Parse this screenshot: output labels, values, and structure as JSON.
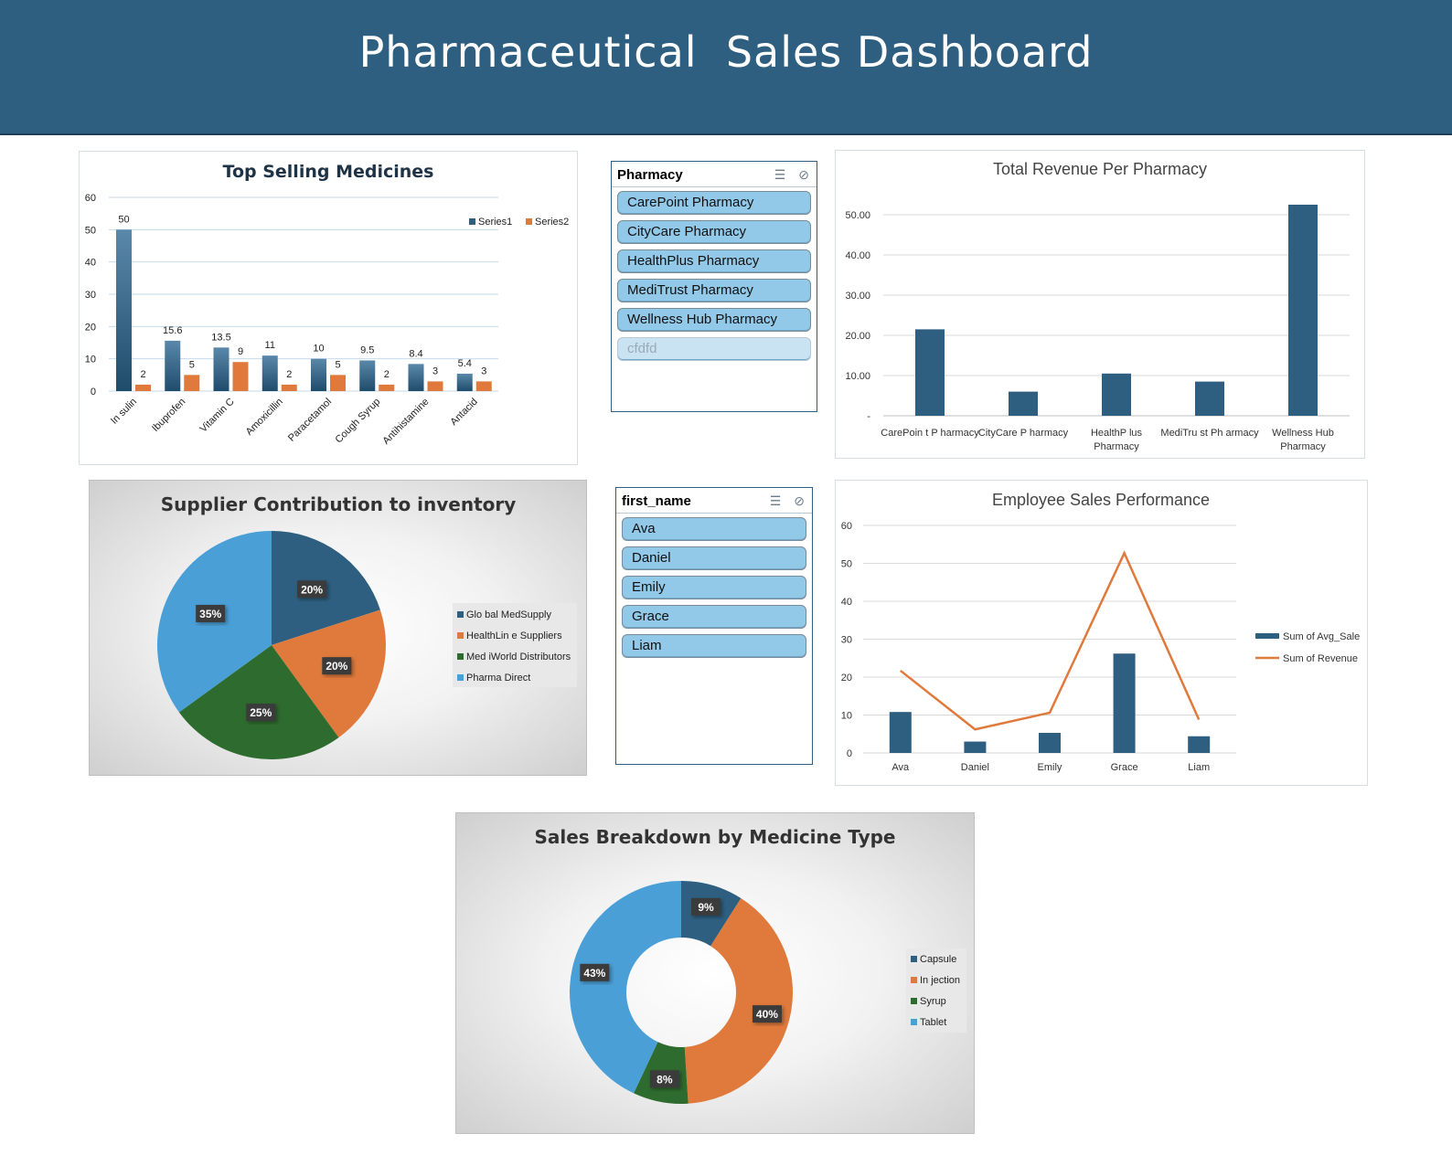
{
  "title": "Pharmaceutical  Sales Dashboard",
  "slicers": {
    "pharmacy": {
      "title": "Pharmacy",
      "items": [
        {
          "label": "CarePoint Pharmacy",
          "active": true
        },
        {
          "label": "CityCare Pharmacy",
          "active": true
        },
        {
          "label": "HealthPlus Pharmacy",
          "active": true
        },
        {
          "label": "MediTrust Pharmacy",
          "active": true
        },
        {
          "label": "Wellness Hub Pharmacy",
          "active": true
        },
        {
          "label": "cfdfd",
          "active": false
        }
      ]
    },
    "first_name": {
      "title": "first_name",
      "items": [
        {
          "label": "Ava",
          "active": true
        },
        {
          "label": "Daniel",
          "active": true
        },
        {
          "label": "Emily",
          "active": true
        },
        {
          "label": "Grace",
          "active": true
        },
        {
          "label": "Liam",
          "active": true
        }
      ]
    }
  },
  "colors": {
    "dark_blue": "#2e5f80",
    "orange": "#e07a3c",
    "green": "#2e6b2e",
    "light_blue": "#4a9fd6"
  },
  "chart_data": [
    {
      "id": "top_selling",
      "type": "bar",
      "title": "Top Selling Medicines",
      "categories": [
        "Insulin",
        "Ibuprofen",
        "Vitamin C",
        "Amoxicillin",
        "Paracetamol",
        "Cough Syrup",
        "Antihistamine",
        "Antacid"
      ],
      "category_display": [
        "In sulin",
        "Ibuprofen",
        "Vitamin C",
        "Amoxicillin",
        "Paracetamol",
        "Cough Syrup",
        "Antihistamine",
        "Antacid"
      ],
      "series": [
        {
          "name": "Series1",
          "values": [
            50,
            15.6,
            13.5,
            11,
            10,
            9.5,
            8.4,
            5.4
          ]
        },
        {
          "name": "Series2",
          "values": [
            2,
            5,
            9,
            2,
            5,
            2,
            3,
            3
          ]
        }
      ],
      "yticks": [
        0,
        10,
        20,
        30,
        40,
        50,
        60
      ],
      "ylim": [
        0,
        60
      ],
      "legend": "top-right",
      "grid": true
    },
    {
      "id": "revenue_pharmacy",
      "type": "bar",
      "title": "Total Revenue Per Pharmacy",
      "categories": [
        "CarePoint Pharmacy",
        "CityCare Pharmacy",
        "HealthPlus Pharmacy",
        "MediTrust Pharmacy",
        "Wellness Hub Pharmacy"
      ],
      "category_lines": [
        [
          "CarePoin t P harmacy"
        ],
        [
          "CityCare P harmacy"
        ],
        [
          "HealthP lus",
          "Pharmacy"
        ],
        [
          "MediTru st Ph armacy"
        ],
        [
          "Wellness Hub",
          "Pharmacy"
        ]
      ],
      "series": [
        {
          "values": [
            21.5,
            6,
            10.5,
            8.5,
            52.5
          ]
        }
      ],
      "yticks": [
        "-",
        "10.00",
        "20.00",
        "30.00",
        "40.00",
        "50.00"
      ],
      "ylim": [
        0,
        55
      ],
      "grid": true
    },
    {
      "id": "supplier",
      "type": "pie",
      "title": "Supplier Contribution to inventory",
      "labels": [
        "Glo bal MedSupply",
        "HealthLin e Suppliers",
        "Med iWorld Distributors",
        "Pharma Direct"
      ],
      "values": [
        20,
        20,
        25,
        35
      ],
      "value_labels": [
        "20%",
        "20%",
        "25%",
        "35%"
      ],
      "legend": "right"
    },
    {
      "id": "employee",
      "type": "bar",
      "title": "Employee Sales Performance",
      "categories": [
        "Ava",
        "Daniel",
        "Emily",
        "Grace",
        "Liam"
      ],
      "series": [
        {
          "name": "Sum of Avg_Sale",
          "kind": "bar",
          "values": [
            10.8,
            3,
            5.3,
            26.2,
            4.4
          ]
        },
        {
          "name": "Sum of Revenue",
          "kind": "line",
          "values": [
            21.7,
            6.2,
            10.6,
            52.7,
            8.8
          ]
        }
      ],
      "yticks": [
        0,
        10,
        20,
        30,
        40,
        50,
        60
      ],
      "ylim": [
        0,
        60
      ],
      "legend": "right",
      "grid": true
    },
    {
      "id": "medicine_type",
      "type": "pie",
      "donut": true,
      "title": "Sales Breakdown by Medicine Type",
      "labels": [
        "Capsule",
        "In jection",
        "Syrup",
        "Tablet"
      ],
      "values": [
        9,
        40,
        8,
        43
      ],
      "value_labels": [
        "9%",
        "40%",
        "8%",
        "43%"
      ],
      "legend": "right"
    }
  ]
}
